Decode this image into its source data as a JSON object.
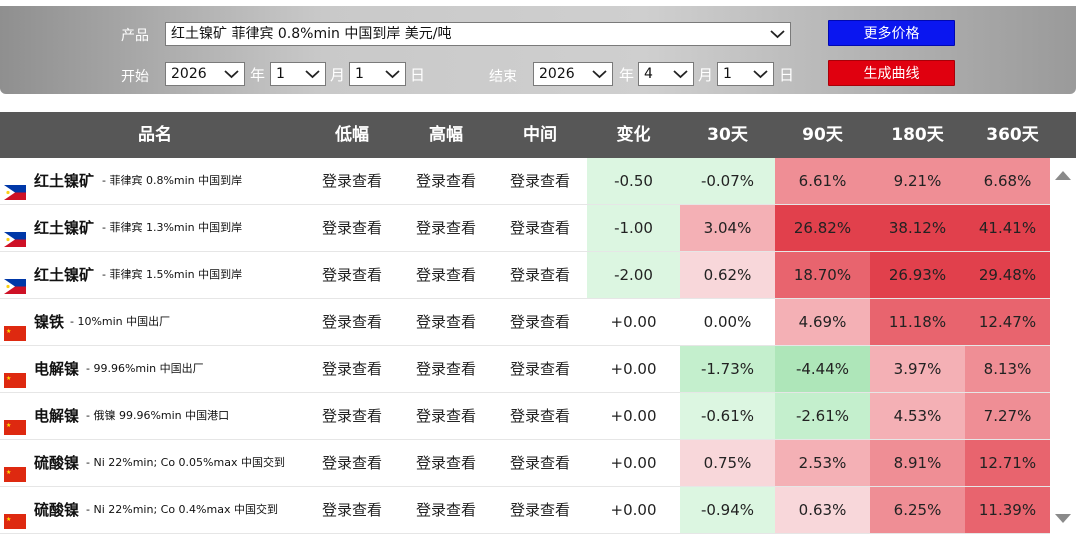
{
  "filters": {
    "product_label": "产品",
    "product_value": "红土镍矿 菲律宾 0.8%min 中国到岸 美元/吨",
    "start_label": "开始",
    "end_label": "结束",
    "start": {
      "year": "2026",
      "month": "1",
      "day": "1"
    },
    "end": {
      "year": "2026",
      "month": "4",
      "day": "1"
    },
    "year_unit": "年",
    "month_unit": "月",
    "day_unit": "日",
    "more_prices_label": "更多价格",
    "generate_curve_label": "生成曲线"
  },
  "table": {
    "headers": [
      "品名",
      "低幅",
      "高幅",
      "中间",
      "变化",
      "30天",
      "90天",
      "180天",
      "360天"
    ],
    "rows": [
      {
        "flag": "philippines-flag-icon",
        "name": "红土镍矿",
        "desc": "- 菲律宾 0.8%min 中国到岸",
        "low": "登录查看",
        "high": "登录查看",
        "mid": "登录查看",
        "change": "-0.50",
        "d30": "-0.07%",
        "d90": "6.61%",
        "d180": "9.21%",
        "d360": "6.68%"
      },
      {
        "flag": "philippines-flag-icon",
        "name": "红土镍矿",
        "desc": "- 菲律宾 1.3%min 中国到岸",
        "low": "登录查看",
        "high": "登录查看",
        "mid": "登录查看",
        "change": "-1.00",
        "d30": "3.04%",
        "d90": "26.82%",
        "d180": "38.12%",
        "d360": "41.41%"
      },
      {
        "flag": "philippines-flag-icon",
        "name": "红土镍矿",
        "desc": "- 菲律宾 1.5%min 中国到岸",
        "low": "登录查看",
        "high": "登录查看",
        "mid": "登录查看",
        "change": "-2.00",
        "d30": "0.62%",
        "d90": "18.70%",
        "d180": "26.93%",
        "d360": "29.48%"
      },
      {
        "flag": "china-flag-icon",
        "name": "镍铁",
        "desc": "- 10%min 中国出厂",
        "low": "登录查看",
        "high": "登录查看",
        "mid": "登录查看",
        "change": "+0.00",
        "d30": "0.00%",
        "d90": "4.69%",
        "d180": "11.18%",
        "d360": "12.47%"
      },
      {
        "flag": "china-flag-icon",
        "name": "电解镍",
        "desc": "- 99.96%min 中国出厂",
        "low": "登录查看",
        "high": "登录查看",
        "mid": "登录查看",
        "change": "+0.00",
        "d30": "-1.73%",
        "d90": "-4.44%",
        "d180": "3.97%",
        "d360": "8.13%"
      },
      {
        "flag": "china-flag-icon",
        "name": "电解镍",
        "desc": "- 俄镍 99.96%min 中国港口",
        "low": "登录查看",
        "high": "登录查看",
        "mid": "登录查看",
        "change": "+0.00",
        "d30": "-0.61%",
        "d90": "-2.61%",
        "d180": "4.53%",
        "d360": "7.27%"
      },
      {
        "flag": "china-flag-icon",
        "name": "硫酸镍",
        "desc": "- Ni 22%min; Co 0.05%max 中国交到",
        "low": "登录查看",
        "high": "登录查看",
        "mid": "登录查看",
        "change": "+0.00",
        "d30": "0.75%",
        "d90": "2.53%",
        "d180": "8.91%",
        "d360": "12.71%"
      },
      {
        "flag": "china-flag-icon",
        "name": "硫酸镍",
        "desc": "- Ni 22%min; Co 0.4%max 中国交到",
        "low": "登录查看",
        "high": "登录查看",
        "mid": "登录查看",
        "change": "+0.00",
        "d30": "-0.94%",
        "d90": "0.63%",
        "d180": "6.25%",
        "d360": "11.39%"
      }
    ]
  },
  "colors": {
    "header_bg": "#575757",
    "pos_1": "#f8d7da",
    "pos_2": "#f4b0b5",
    "pos_3": "#ef8e95",
    "pos_4": "#e8646e",
    "pos_5": "#e1404c",
    "neg_1": "#dcf6e1",
    "neg_2": "#c4efcd",
    "neg_3": "#aee6b9"
  }
}
